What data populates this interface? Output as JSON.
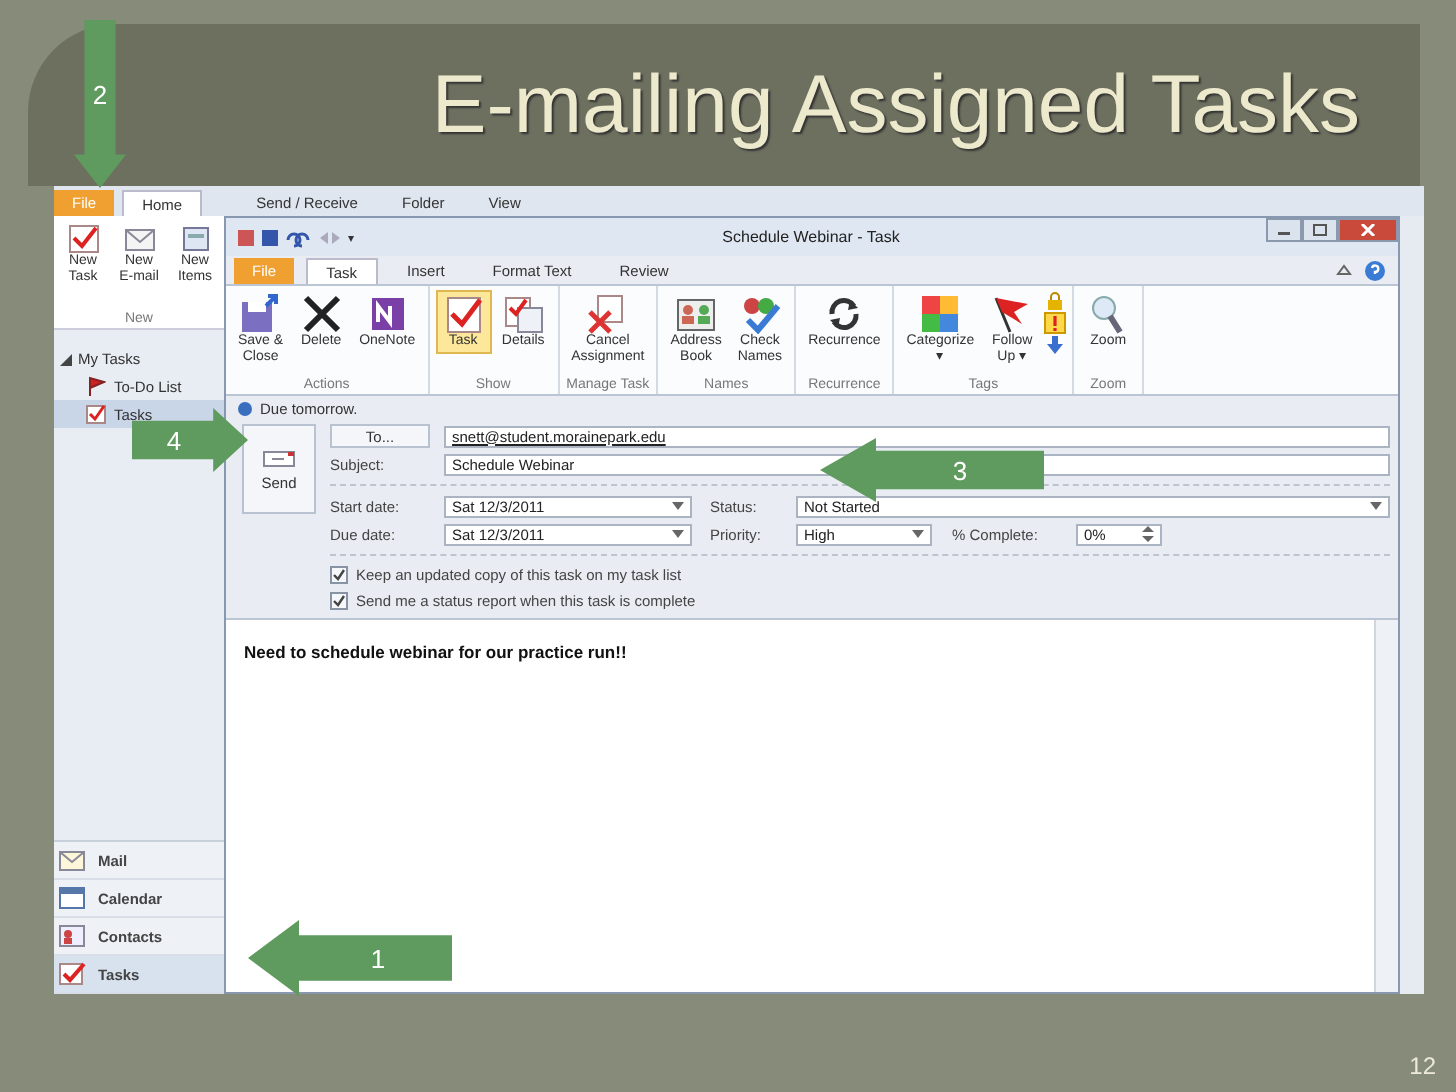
{
  "slide": {
    "title": "E-mailing Assigned Tasks",
    "page_number": "12"
  },
  "callouts": [
    {
      "label": "2",
      "kind": "down"
    },
    {
      "label": "4",
      "kind": "right"
    },
    {
      "label": "3",
      "kind": "left"
    },
    {
      "label": "1",
      "kind": "left"
    }
  ],
  "main_window": {
    "tabs": [
      {
        "label": "File",
        "kind": "file",
        "selected": false
      },
      {
        "label": "Home",
        "kind": "tab",
        "selected": true
      },
      {
        "label": "Send / Receive",
        "kind": "tab",
        "selected": false
      },
      {
        "label": "Folder",
        "kind": "tab",
        "selected": false
      },
      {
        "label": "View",
        "kind": "tab",
        "selected": false
      }
    ],
    "ribbon_buttons": [
      {
        "label": "New\nTask",
        "kind": "task"
      },
      {
        "label": "New\nE-mail",
        "kind": "mail"
      },
      {
        "label": "New\nItems",
        "kind": "items"
      }
    ],
    "ribbon_group": "New",
    "nav_header": "My Tasks",
    "nav_items": [
      {
        "label": "To-Do List",
        "kind": "flag",
        "selected": false
      },
      {
        "label": "Tasks",
        "kind": "tasks",
        "selected": true
      }
    ],
    "bottom_nav": [
      {
        "label": "Mail",
        "kind": "mail",
        "selected": false
      },
      {
        "label": "Calendar",
        "kind": "calendar",
        "selected": false
      },
      {
        "label": "Contacts",
        "kind": "contacts",
        "selected": false
      },
      {
        "label": "Tasks",
        "kind": "tasks",
        "selected": true
      }
    ]
  },
  "task_window": {
    "title": "Schedule Webinar - Task",
    "tabs": [
      {
        "label": "File",
        "kind": "file",
        "selected": false
      },
      {
        "label": "Task",
        "kind": "tab",
        "selected": true
      },
      {
        "label": "Insert",
        "kind": "tab",
        "selected": false
      },
      {
        "label": "Format Text",
        "kind": "tab",
        "selected": false
      },
      {
        "label": "Review",
        "kind": "tab",
        "selected": false
      }
    ],
    "ribbon_groups": [
      {
        "label": "Actions",
        "buttons": [
          {
            "label": "Save &\nClose",
            "kind": "save",
            "selected": false
          },
          {
            "label": "Delete",
            "kind": "delete",
            "selected": false
          },
          {
            "label": "OneNote",
            "kind": "onenote",
            "selected": false
          }
        ]
      },
      {
        "label": "Show",
        "buttons": [
          {
            "label": "Task",
            "kind": "task",
            "selected": true
          },
          {
            "label": "Details",
            "kind": "details",
            "selected": false
          }
        ]
      },
      {
        "label": "Manage Task",
        "buttons": [
          {
            "label": "Cancel\nAssignment",
            "kind": "cancel",
            "selected": false
          }
        ]
      },
      {
        "label": "Names",
        "buttons": [
          {
            "label": "Address\nBook",
            "kind": "book",
            "selected": false
          },
          {
            "label": "Check\nNames",
            "kind": "check",
            "selected": false
          }
        ]
      },
      {
        "label": "Recurrence",
        "buttons": [
          {
            "label": "Recurrence",
            "kind": "recurrence",
            "selected": false
          }
        ]
      },
      {
        "label": "Tags",
        "kind": "tags",
        "buttons": [
          {
            "label": "Categorize\n▾",
            "kind": "categorize",
            "selected": false
          },
          {
            "label": "Follow\nUp ▾",
            "kind": "flag",
            "selected": false
          }
        ]
      },
      {
        "label": "Zoom",
        "buttons": [
          {
            "label": "Zoom",
            "kind": "zoom",
            "selected": false
          }
        ]
      }
    ],
    "info": "Due tomorrow.",
    "send_button": "Send",
    "to_button": "To...",
    "to_value": "snett@student.morainepark.edu",
    "subject_label": "Subject:",
    "subject_value": "Schedule Webinar",
    "start_label": "Start date:",
    "start_value": "Sat 12/3/2011",
    "due_label": "Due date:",
    "due_value": "Sat 12/3/2011",
    "status_label": "Status:",
    "status_value": "Not Started",
    "priority_label": "Priority:",
    "priority_value": "High",
    "complete_label": "% Complete:",
    "complete_value": "0%",
    "checkboxes": [
      {
        "label": "Keep an updated copy of this task on my task list",
        "checked": true
      },
      {
        "label": "Send me a status report when this task is complete",
        "checked": true
      }
    ],
    "body": "Need to schedule webinar for our practice run!!"
  }
}
